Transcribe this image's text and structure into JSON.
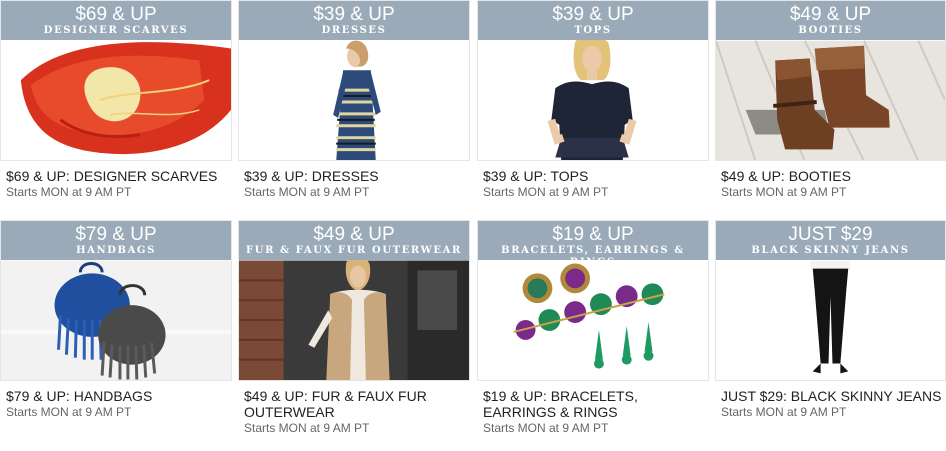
{
  "cards": [
    {
      "price": "$69 & UP",
      "category": "DESIGNER SCARVES",
      "title": "$69 & UP: DESIGNER SCARVES",
      "start": "Starts MON at 9 AM PT",
      "image": "red-silk-scarf"
    },
    {
      "price": "$39 & UP",
      "category": "DRESSES",
      "title": "$39 & UP: DRESSES",
      "start": "Starts MON at 9 AM PT",
      "image": "patterned-dress"
    },
    {
      "price": "$39 & UP",
      "category": "TOPS",
      "title": "$39 & UP: TOPS",
      "start": "Starts MON at 9 AM PT",
      "image": "navy-peplum-top"
    },
    {
      "price": "$49 & UP",
      "category": "BOOTIES",
      "title": "$49 & UP: BOOTIES",
      "start": "Starts MON at 9 AM PT",
      "image": "brown-fringe-booties"
    },
    {
      "price": "$79 & UP",
      "category": "HANDBAGS",
      "title": "$79 & UP: HANDBAGS",
      "start": "Starts MON at 9 AM PT",
      "image": "fringe-handbags"
    },
    {
      "price": "$49 & UP",
      "category": "FUR & FAUX FUR OUTERWEAR",
      "title": "$49 & UP: FUR & FAUX FUR OUTERWEAR",
      "start": "Starts MON at 9 AM PT",
      "image": "fur-vest"
    },
    {
      "price": "$19 & UP",
      "category": "BRACELETS, EARRINGS & RINGS",
      "title": "$19 & UP: BRACELETS, EARRINGS & RINGS",
      "start": "Starts MON at 9 AM PT",
      "image": "jewel-bracelet-earrings"
    },
    {
      "price": "JUST $29",
      "category": "BLACK SKINNY JEANS",
      "title": "JUST $29: BLACK SKINNY JEANS",
      "start": "Starts MON at 9 AM PT",
      "image": "black-skinny-jeans"
    }
  ]
}
